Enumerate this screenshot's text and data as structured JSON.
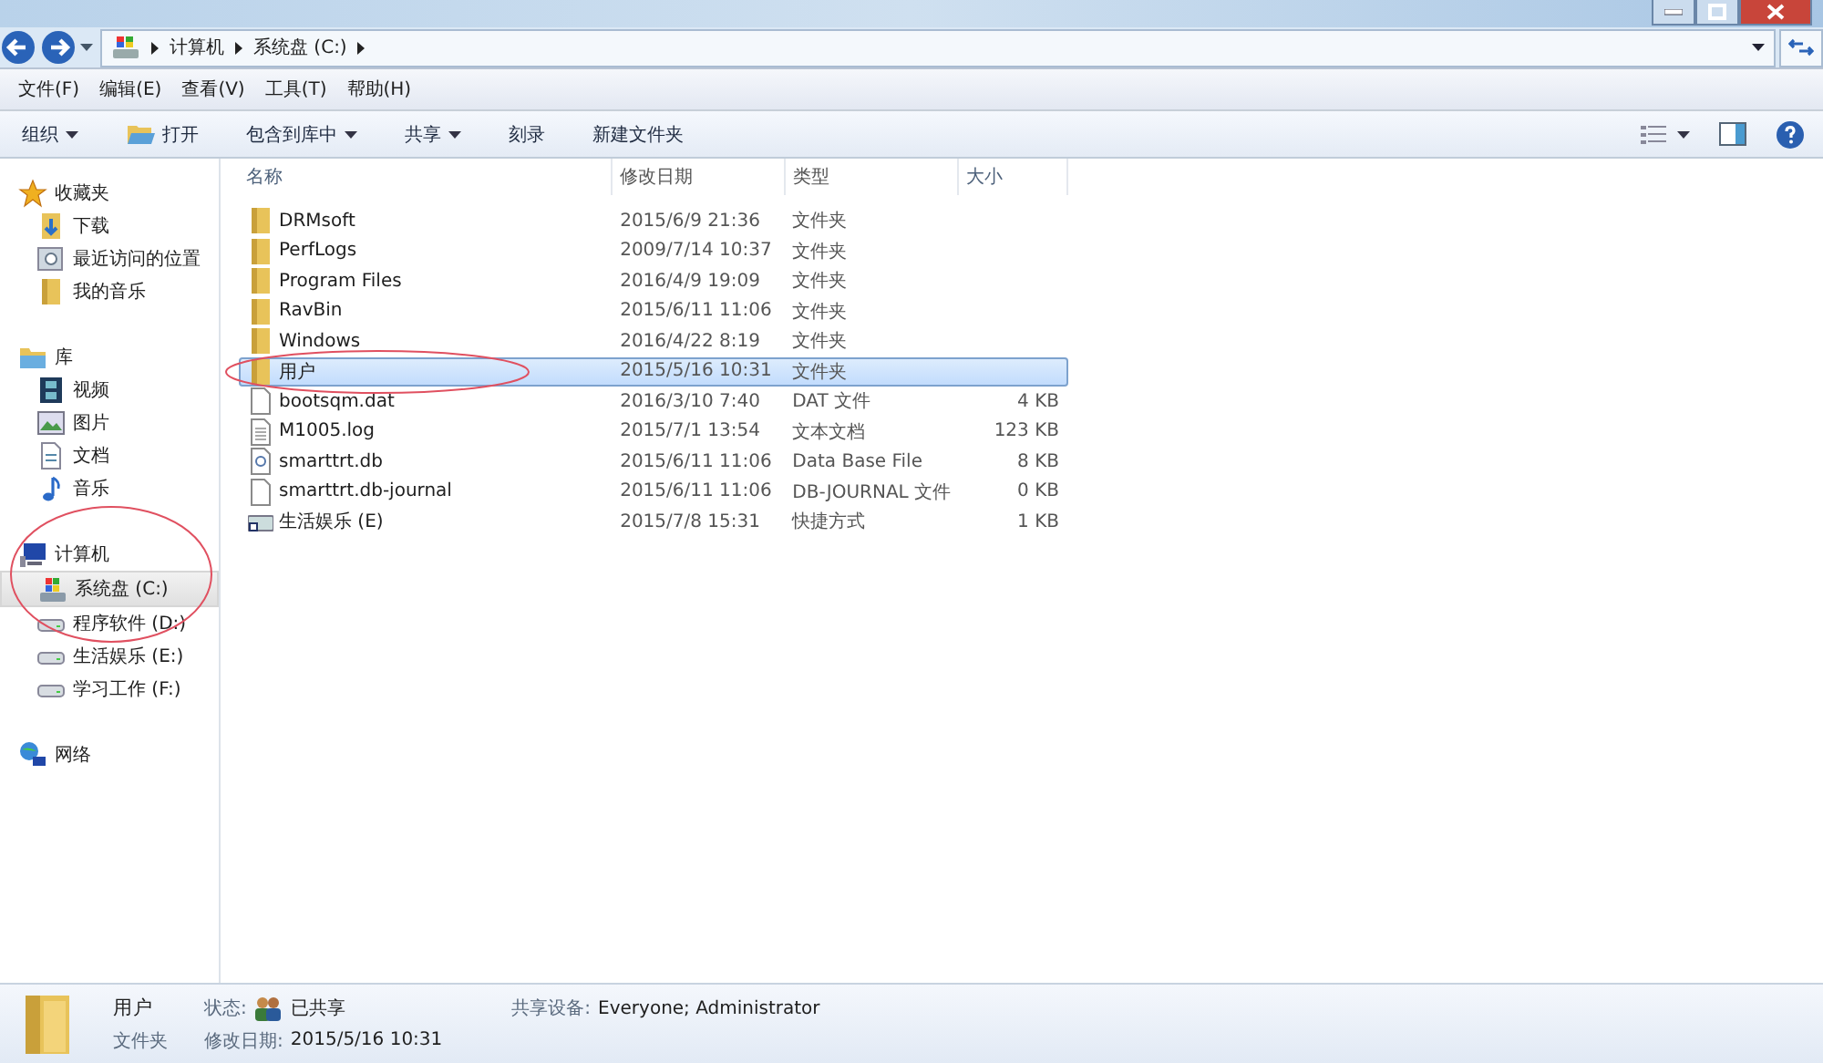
{
  "address": {
    "crumbs": [
      "计算机",
      "系统盘 (C:)"
    ]
  },
  "menu": [
    "文件(F)",
    "编辑(E)",
    "查看(V)",
    "工具(T)",
    "帮助(H)"
  ],
  "toolbar": [
    {
      "label": "组织",
      "kind": "dropdown"
    },
    {
      "label": "打开",
      "kind": "open"
    },
    {
      "label": "包含到库中",
      "kind": "dropdown"
    },
    {
      "label": "共享",
      "kind": "dropdown"
    },
    {
      "label": "刻录",
      "kind": "plain"
    },
    {
      "label": "新建文件夹",
      "kind": "plain"
    }
  ],
  "sidebar": [
    {
      "label": "收藏夹",
      "kind": "star",
      "selected": false,
      "children": [
        {
          "label": "下载",
          "kind": "download",
          "selected": false
        },
        {
          "label": "最近访问的位置",
          "kind": "recent",
          "selected": false
        },
        {
          "label": "我的音乐",
          "kind": "folder",
          "selected": false
        }
      ]
    },
    {
      "label": "库",
      "kind": "library",
      "selected": false,
      "children": [
        {
          "label": "视频",
          "kind": "video",
          "selected": false
        },
        {
          "label": "图片",
          "kind": "image",
          "selected": false
        },
        {
          "label": "文档",
          "kind": "doc",
          "selected": false
        },
        {
          "label": "音乐",
          "kind": "music",
          "selected": false
        }
      ]
    },
    {
      "label": "计算机",
      "kind": "computer",
      "selected": false,
      "children": [
        {
          "label": "系统盘 (C:)",
          "kind": "sysdrive",
          "selected": true
        },
        {
          "label": "程序软件 (D:)",
          "kind": "drive",
          "selected": false
        },
        {
          "label": "生活娱乐 (E:)",
          "kind": "drive",
          "selected": false
        },
        {
          "label": "学习工作 (F:)",
          "kind": "drive",
          "selected": false
        }
      ]
    },
    {
      "label": "网络",
      "kind": "network",
      "selected": false
    }
  ],
  "table": {
    "columns": [
      "名称",
      "修改日期",
      "类型",
      "大小"
    ],
    "rows": [
      {
        "name": "DRMsoft",
        "date": "2015/6/9 21:36",
        "type": "文件夹",
        "kind": "folder",
        "selected": false
      },
      {
        "name": "PerfLogs",
        "date": "2009/7/14 10:37",
        "type": "文件夹",
        "kind": "folder",
        "selected": false
      },
      {
        "name": "Program Files",
        "date": "2016/4/9 19:09",
        "type": "文件夹",
        "kind": "folder",
        "selected": false
      },
      {
        "name": "RavBin",
        "date": "2015/6/11 11:06",
        "type": "文件夹",
        "kind": "folder",
        "selected": false
      },
      {
        "name": "Windows",
        "date": "2016/4/22 8:19",
        "type": "文件夹",
        "kind": "folder",
        "selected": false
      },
      {
        "name": "用户",
        "date": "2015/5/16 10:31",
        "type": "文件夹",
        "kind": "folder",
        "selected": true
      },
      {
        "name": "bootsqm.dat",
        "date": "2016/3/10 7:40",
        "type": "DAT 文件",
        "size": "4 KB",
        "kind": "file",
        "selected": false
      },
      {
        "name": "M1005.log",
        "date": "2015/7/1 13:54",
        "type": "文本文档",
        "size": "123 KB",
        "kind": "text",
        "selected": false
      },
      {
        "name": "smarttrt.db",
        "date": "2015/6/11 11:06",
        "type": "Data Base File",
        "size": "8 KB",
        "kind": "db",
        "selected": false
      },
      {
        "name": "smarttrt.db-journal",
        "date": "2015/6/11 11:06",
        "type": "DB-JOURNAL 文件",
        "size": "0 KB",
        "kind": "file",
        "selected": false
      },
      {
        "name": "生活娱乐 (E)",
        "date": "2015/7/8 15:31",
        "type": "快捷方式",
        "size": "1 KB",
        "kind": "shortcut",
        "selected": false
      }
    ]
  },
  "details": {
    "name": "用户",
    "type": "文件夹",
    "status_label": "状态:",
    "status": "已共享",
    "modified_label": "修改日期:",
    "modified": "2015/5/16 10:31",
    "shared_label": "共享设备:",
    "shared": "Everyone; Administrator"
  }
}
